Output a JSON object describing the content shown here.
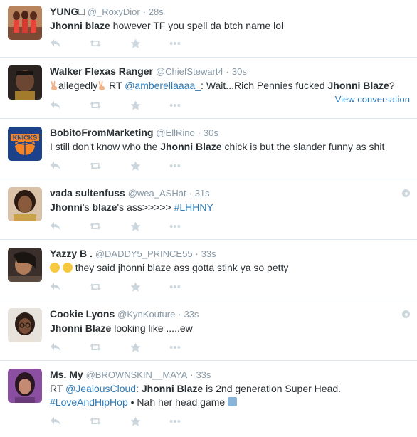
{
  "tweets": [
    {
      "fullname": "YUNG□",
      "username": "@_RoxyDior",
      "sep": "·",
      "time": "28s",
      "text_bold1": "Jhonni blaze",
      "text_rest": " however TF you spell da btch name lol"
    },
    {
      "fullname": "Walker Flexas Ranger",
      "username": "@ChiefStewart4",
      "sep": "·",
      "time": "30s",
      "text_pre": "allegedly",
      "text_rt": " RT ",
      "text_mention": "@amberellaaaa_",
      "text_mid": ": Wait...Rich Pennies fucked ",
      "text_bold": "Jhonni Blaze",
      "text_end": "?",
      "view_conversation": "View conversation"
    },
    {
      "fullname": "BobitoFromMarketing",
      "username": "@EllRino",
      "sep": "·",
      "time": "30s",
      "text_pre": "I still don't know who the ",
      "text_bold": "Jhonni Blaze",
      "text_end": " chick is but the slander funny as shit"
    },
    {
      "fullname": "vada sultenfuss",
      "username": "@wea_ASHat",
      "sep": "·",
      "time": "31s",
      "text_bold1": "Jhonni",
      "text_mid1": "'s ",
      "text_bold2": "blaze",
      "text_mid2": "'s ass>>>>> ",
      "text_hashtag": "#LHHNY"
    },
    {
      "fullname": "Yazzy B .",
      "username": "@DADDY5_PRINCE55",
      "sep": "·",
      "time": "33s",
      "text_rest": " they said jhonni blaze ass gotta stink ya so petty"
    },
    {
      "fullname": "Cookie Lyons",
      "username": "@KynKouture",
      "sep": "·",
      "time": "33s",
      "text_bold1": "Jhonni Blaze",
      "text_rest": " looking like .....ew"
    },
    {
      "fullname": "Ms. My",
      "username": "@BROWNSKIN__MAYA",
      "sep": "·",
      "time": "33s",
      "line1_rt": "RT ",
      "line1_mention": "@JealousCloud",
      "line1_colon": ": ",
      "line1_bold": "Jhonni Blaze",
      "line1_rest": " is 2nd generation Super Head.",
      "line2_hashtag": "#LoveAndHipHop",
      "line2_rest": " • Nah her head game "
    }
  ],
  "colors": {
    "link": "#2b7bb9",
    "muted": "#8899a6",
    "action_icon": "#ccd6dd",
    "divider": "#e1e8ed"
  },
  "icons": [
    "reply-icon",
    "retweet-icon",
    "favorite-icon",
    "more-icon"
  ]
}
